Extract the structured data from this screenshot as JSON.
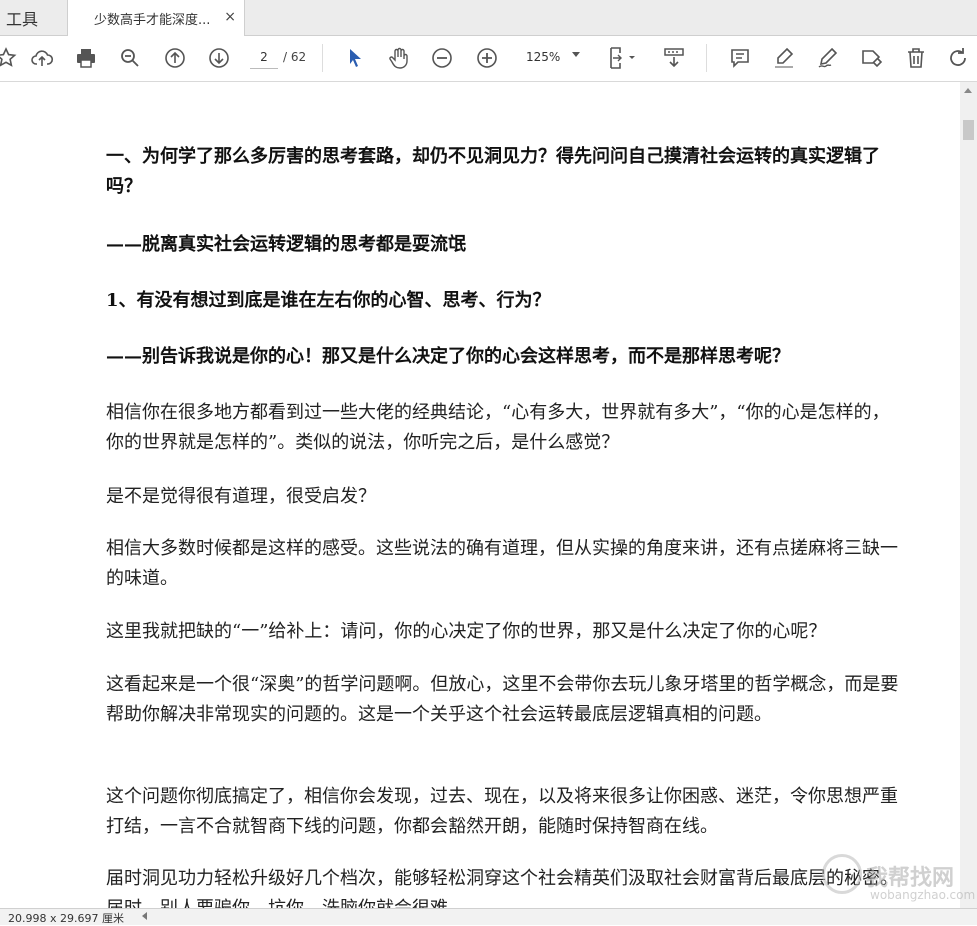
{
  "tabs": {
    "tools_label": "工具",
    "document_title": "少数高手才能深度...",
    "close_glyph": "×"
  },
  "toolbar": {
    "page_current": "2",
    "page_total": "/ 62",
    "zoom": "125%",
    "icons": [
      "star-icon",
      "upload-icon",
      "print-icon",
      "search-icon",
      "prev-page-icon",
      "next-page-icon",
      "select-cursor-icon",
      "hand-icon",
      "zoom-out-icon",
      "zoom-in-icon",
      "fit-page-icon",
      "scroll-mode-icon",
      "comment-icon",
      "highlight-icon",
      "sign-icon",
      "stamp-icon",
      "delete-icon",
      "rotate-icon"
    ]
  },
  "document": {
    "paragraphs": [
      {
        "text": "一、为何学了那么多厉害的思考套路，却仍不见洞见力？得先问问自己摸清社会运转的真实逻辑了吗？",
        "bold": true
      },
      {
        "text": "——脱离真实社会运转逻辑的思考都是耍流氓",
        "bold": true
      },
      {
        "text": "1、有没有想过到底是谁在左右你的心智、思考、行为？",
        "bold": true
      },
      {
        "text": "——别告诉我说是你的心！那又是什么决定了你的心会这样思考，而不是那样思考呢？",
        "bold": true
      },
      {
        "text": "相信你在很多地方都看到过一些大佬的经典结论，“心有多大，世界就有多大”，“你的心是怎样的，你的世界就是怎样的”。类似的说法，你听完之后，是什么感觉？",
        "bold": false
      },
      {
        "text": "是不是觉得很有道理，很受启发？",
        "bold": false
      },
      {
        "text": "相信大多数时候都是这样的感受。这些说法的确有道理，但从实操的角度来讲，还有点搓麻将三缺一的味道。",
        "bold": false
      },
      {
        "text": "这里我就把缺的“一”给补上：请问，你的心决定了你的世界，那又是什么决定了你的心呢？",
        "bold": false
      },
      {
        "text": "这看起来是一个很“深奥”的哲学问题啊。但放心，这里不会带你去玩儿象牙塔里的哲学概念，而是要帮助你解决非常现实的问题的。这是一个关乎这个社会运转最底层逻辑真相的问题。",
        "bold": false
      },
      {
        "text": "这个问题你彻底搞定了，相信你会发现，过去、现在，以及将来很多让你困惑、迷茫，令你思想严重打结，一言不合就智商下线的问题，你都会豁然开朗，能随时保持智商在线。",
        "bold": false
      },
      {
        "text": "届时洞见功力轻松升级好几个档次，能够轻松洞穿这个社会精英们汲取社会财富背后最底层的秘密。届时，别人要骗你、坑你、洗脑你就会很难",
        "bold": false
      }
    ]
  },
  "status": {
    "page_size": "20.998 x 29.697 厘米"
  },
  "watermark": {
    "line1": "我帮找网",
    "line2": "wobangzhao.com"
  }
}
